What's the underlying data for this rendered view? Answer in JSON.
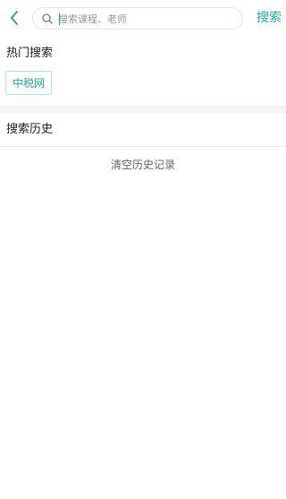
{
  "header": {
    "back_icon": "chevron-left-icon",
    "search_icon": "search-icon",
    "search_placeholder": "搜索课程、老师",
    "search_button_label": "搜索",
    "accent_color": "#2aa59b"
  },
  "hot_search": {
    "title": "热门搜索",
    "tags": [
      "中税网"
    ]
  },
  "history": {
    "title": "搜索历史",
    "clear_label": "清空历史记录"
  }
}
